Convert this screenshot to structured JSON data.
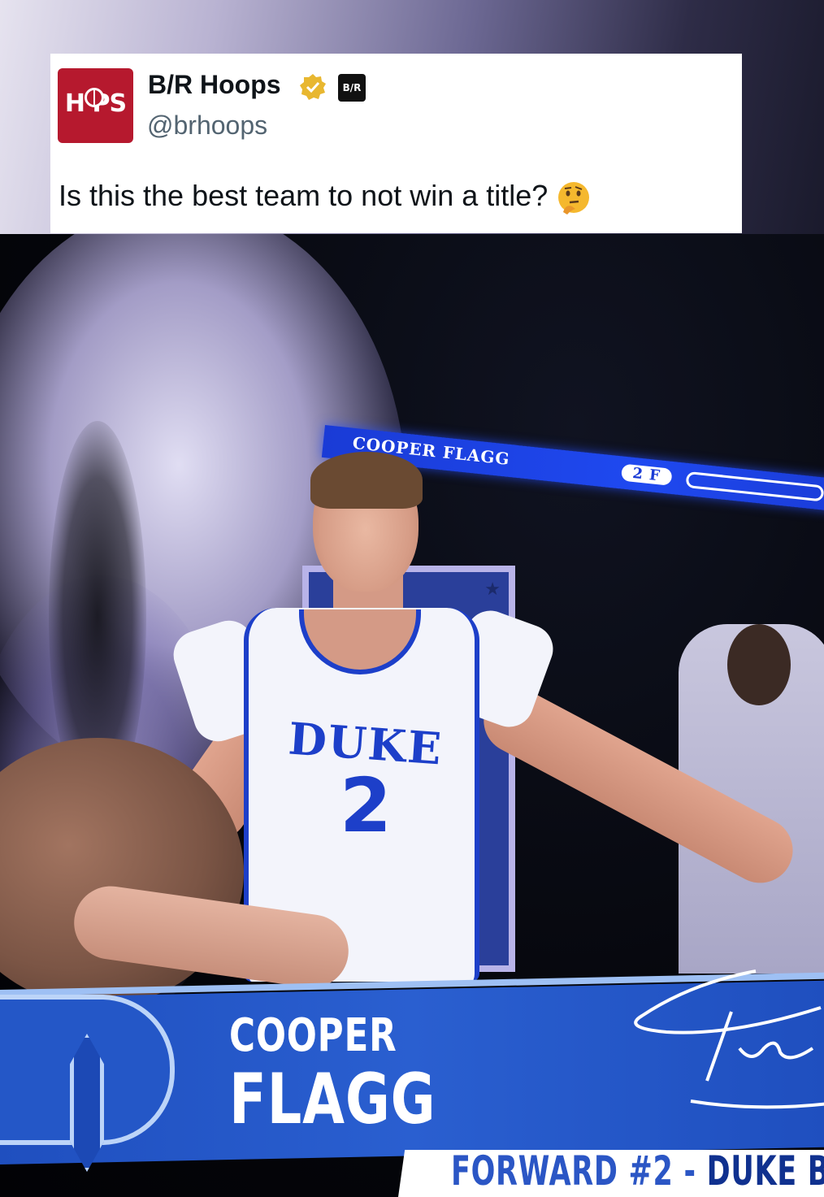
{
  "tweet": {
    "avatar_text": "H  PS",
    "account_name": "B/R Hoops",
    "badge_label": "B/R",
    "handle": "@brhoops",
    "text": "Is this the best team to not win a title?",
    "emoji": "thinking-face"
  },
  "video": {
    "ribbon": {
      "name": "COOPER FLAGG",
      "number_position": "2  F",
      "logo": "D"
    },
    "jersey": {
      "team": "DUKE",
      "number": "2"
    },
    "lower_third": {
      "first_name": "COOPER",
      "last_name": "FLAGG",
      "position": "FORWARD #2  - ",
      "team": "DUKE BL"
    }
  },
  "colors": {
    "duke_blue": "#1f4fbf",
    "avatar_red": "#b6192e",
    "verified_gold": "#e8b730"
  }
}
